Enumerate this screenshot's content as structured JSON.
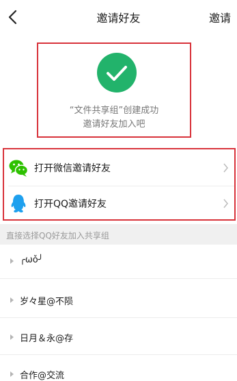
{
  "header": {
    "title": "邀请好友",
    "action_label": "邀请",
    "back_icon": "back-chevron-icon"
  },
  "success": {
    "icon": "check-circle-icon",
    "line1": "“文件共享组”创建成功",
    "line2": "邀请好友加入吧",
    "accent_color": "#22b36b"
  },
  "options": [
    {
      "label": "打开微信邀请好友",
      "icon": "wechat-icon"
    },
    {
      "label": "打开QQ邀请好友",
      "icon": "qq-icon"
    }
  ],
  "section": {
    "label": "直接选择QQ好友加入共享组"
  },
  "groups": [
    {
      "name": "╭ωǒ╯"
    },
    {
      "name": "岁々星@不陨"
    },
    {
      "name": "日月＆永@存"
    },
    {
      "name": "合作@交流"
    }
  ],
  "colors": {
    "highlight_border": "#d8323a",
    "section_bg": "#f0f0f0",
    "secondary_text": "#777777"
  }
}
